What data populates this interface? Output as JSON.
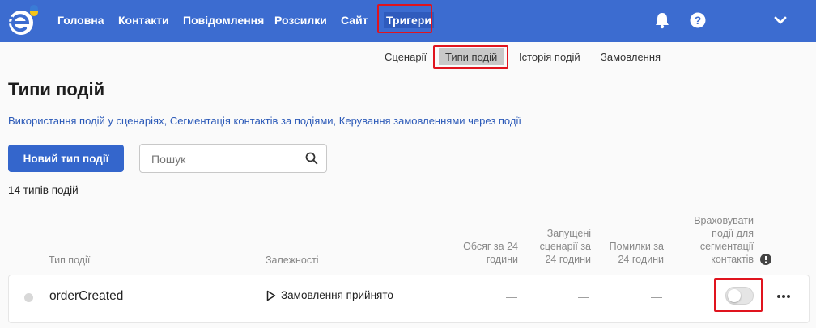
{
  "nav": {
    "items": [
      {
        "label": "Головна"
      },
      {
        "label": "Контакти"
      },
      {
        "label": "Повідомлення"
      },
      {
        "label": "Розсилки"
      },
      {
        "label": "Сайт"
      },
      {
        "label": "Тригери"
      }
    ],
    "active": "Тригери"
  },
  "subnav": {
    "items": [
      {
        "label": "Сценарії"
      },
      {
        "label": "Типи подій"
      },
      {
        "label": "Історія подій"
      },
      {
        "label": "Замовлення"
      }
    ],
    "active": "Типи подій"
  },
  "page": {
    "title": "Типи подій",
    "links": [
      "Використання подій у сценаріях,",
      "Сегментація контактів за подіями,",
      "Керування замовленнями через події"
    ],
    "new_button": "Новий тип події",
    "search_placeholder": "Пошук",
    "count_text": "14 типів подій"
  },
  "table": {
    "headers": {
      "event_type": "Тип події",
      "dependencies": "Залежності",
      "volume": [
        "Обсяг за 24",
        "години"
      ],
      "launched": [
        "Запущені",
        "сценарії за",
        "24 години"
      ],
      "errors": [
        "Помилки за",
        "24 години"
      ],
      "segmentation": [
        "Враховувати",
        "події для",
        "сегментації",
        "контактів"
      ]
    },
    "rows": [
      {
        "name": "orderCreated",
        "dependency": "Замовлення прийнято",
        "volume": "—",
        "launched": "—",
        "errors": "—",
        "segmentation_enabled": false
      }
    ]
  },
  "colors": {
    "topbar": "#3c6cd0",
    "primary_button": "#3466cc",
    "link": "#2c5ab8",
    "highlight": "#e0141e",
    "logo_accent_blue": "#3a7bd5",
    "logo_accent_yellow": "#f5c518"
  },
  "icons": [
    "logo-icon",
    "bell-icon",
    "help-icon",
    "chevron-down-icon",
    "search-icon",
    "play-icon",
    "warning-icon",
    "more-icon"
  ]
}
